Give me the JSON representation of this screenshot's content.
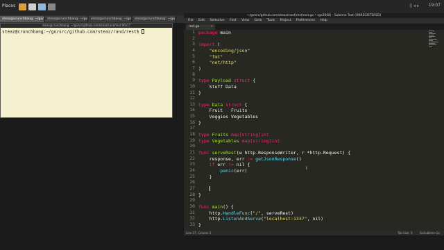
{
  "panel": {
    "menu_label": "Places",
    "clock": "19:07",
    "tray": "|| ◂ ▸"
  },
  "taskbar": {
    "items": [
      "steaz@crunchbang: ~/go/src/github.com/steaz/rand/rest",
      "steaz@crunchbang: ~/go/src/github.c",
      "steaz@crunchbang: ~/go/src/github.c",
      "steaz@crunchbang: ~/go/src/github.c"
    ]
  },
  "terminal": {
    "title": "steaz@crunchbang: ~/go/src/github.com/steaz/rand/rest 90x17",
    "prompt": "steaz@crunchbang:~/go/src/github.com/steaz/rand/rest$ "
  },
  "sublime": {
    "title": "~/go/src/github.com/steaz/rand/rest/rest.go • (go2048) - Sublime Text (UNREGISTERED)",
    "menu": [
      "File",
      "Edit",
      "Selection",
      "Find",
      "View",
      "Goto",
      "Tools",
      "Project",
      "Preferences",
      "Help"
    ],
    "tab_label": "rest.go",
    "tab_close": "×",
    "line_numbers": [
      "1",
      "2",
      "3",
      "4",
      "5",
      "6",
      "7",
      "8",
      "9",
      "10",
      "11",
      "12",
      "13",
      "14",
      "15",
      "16",
      "17",
      "18",
      "19",
      "20",
      "21",
      "22",
      "23",
      "24",
      "25",
      "26",
      "27",
      "28",
      "29",
      "30",
      "31",
      "32",
      "33"
    ],
    "code": {
      "l1_kw": "package",
      "l1_name": " main",
      "l3_kw": "import",
      "l3_rest": " (",
      "l4": "\"encoding/json\"",
      "l5": "\"fmt\"",
      "l6": "\"net/http\"",
      "l7": ")",
      "l9_kw": "type",
      "l9_name": " Payload ",
      "l9_kw2": "struct",
      "l9_rest": " {",
      "l10": "    Stuff Data",
      "l11": "}",
      "l13_kw": "type",
      "l13_name": " Data ",
      "l13_kw2": "struct",
      "l13_rest": " {",
      "l14": "    Fruit   Fruits",
      "l15": "    Veggies Vegetables",
      "l16": "}",
      "l18_kw": "type",
      "l18_name": " Fruits ",
      "l18_type": "map[string]int",
      "l19_kw": "type",
      "l19_name": " Vegetables ",
      "l19_type": "map[string]int",
      "l21_kw": "func",
      "l21_fn": " serveRest",
      "l21_rest": "(w http.ResponseWriter, r *http.Request) {",
      "l22_a": "    response, err ",
      "l22_op": ":=",
      "l22_fn": " getJsonResponse",
      "l22_rest": "()",
      "l23_a": "    ",
      "l23_kw": "if",
      "l23_b": " err ",
      "l23_op": "!=",
      "l23_c": " nil {",
      "l24_a": "        ",
      "l24_fn": "panic",
      "l24_rest": "(err)",
      "l25": "    }",
      "l27": "    ",
      "l28": "}",
      "l30_kw": "func",
      "l30_fn": " main",
      "l30_rest": "() {",
      "l31_a": "    http.",
      "l31_fn": "HandleFunc",
      "l31_b": "(",
      "l31_st": "\"/\"",
      "l31_c": ", serveRest)",
      "l32_a": "    http.",
      "l32_fn": "ListenAndServe",
      "l32_b": "(",
      "l32_st": "\"localhost:1337\"",
      "l32_c": ", nil)",
      "l33": "}"
    },
    "status_left": "Line 27, Column 5",
    "status_tab": "Tab Size: 4",
    "status_syntax": "GoSublime-Go"
  },
  "colors": {
    "keyword": "#f92672",
    "string": "#e6db74",
    "function": "#a6e22e",
    "type": "#66d9ef",
    "editor_bg": "#272822",
    "terminal_bg": "#f5f0d0"
  }
}
